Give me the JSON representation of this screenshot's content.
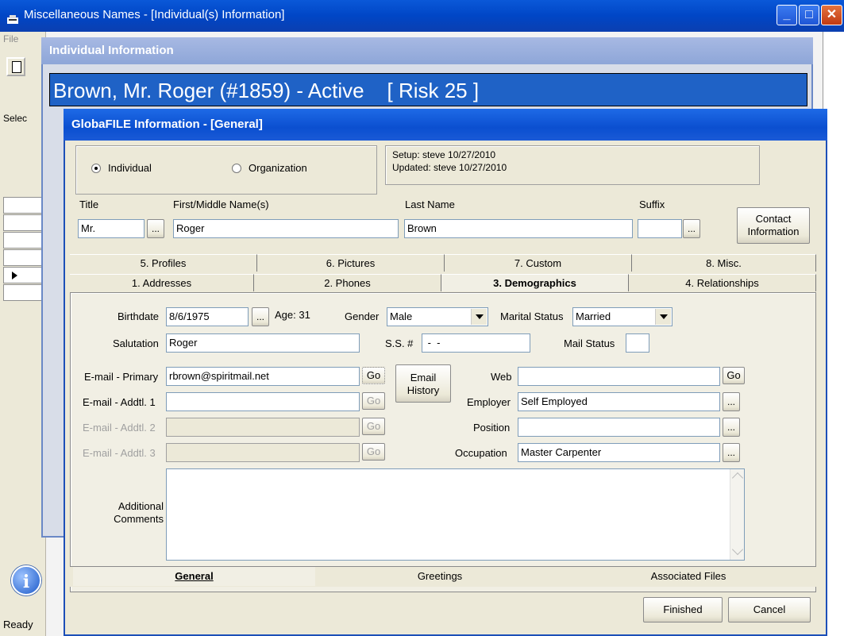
{
  "main_window": {
    "title": "Miscellaneous Names - [Individual(s) Information]",
    "menu_file": "File",
    "select_label": "Selec",
    "status": "Ready",
    "icons": {
      "app": "app-icon",
      "new": "new-document-icon",
      "info": "info-icon"
    }
  },
  "individual_window": {
    "title": "Individual Information",
    "banner": "Brown, Mr. Roger (#1859) - Active    [ Risk 25 ]"
  },
  "dialog": {
    "title": "GlobaFILE Information - [General]",
    "type": {
      "individual": "Individual",
      "organization": "Organization",
      "selected": "Individual"
    },
    "audit": {
      "setup": "Setup: steve 10/27/2010",
      "updated": "Updated: steve 10/27/2010"
    },
    "name": {
      "title_label": "Title",
      "title_value": "Mr.",
      "first_label": "First/Middle Name(s)",
      "first_value": "Roger",
      "last_label": "Last Name",
      "last_value": "Brown",
      "suffix_label": "Suffix",
      "suffix_value": "",
      "dots": "...",
      "contact_button": "Contact Information"
    },
    "tabs_row1": [
      "5. Profiles",
      "6. Pictures",
      "7. Custom",
      "8. Misc."
    ],
    "tabs_row2": [
      "1. Addresses",
      "2. Phones",
      "3. Demographics",
      "4. Relationships"
    ],
    "active_tab": "3. Demographics",
    "demographics": {
      "birthdate_label": "Birthdate",
      "birthdate": "8/6/1975",
      "age": "Age: 31",
      "gender_label": "Gender",
      "gender": "Male",
      "marital_label": "Marital Status",
      "marital": "Married",
      "salutation_label": "Salutation",
      "salutation": "Roger",
      "ss_label": "S.S. #",
      "ss_value": " -  -",
      "mail_status_label": "Mail Status",
      "mail_status": "",
      "email_primary_label": "E-mail - Primary",
      "email_primary": "rbrown@spiritmail.net",
      "email_addtl1_label": "E-mail - Addtl. 1",
      "email_addtl1": "",
      "email_addtl2_label": "E-mail - Addtl. 2",
      "email_addtl2": "",
      "email_addtl3_label": "E-mail - Addtl. 3",
      "email_addtl3": "",
      "go": "Go",
      "email_history": "Email History",
      "web_label": "Web",
      "web": "",
      "employer_label": "Employer",
      "employer": "Self Employed",
      "position_label": "Position",
      "position": "",
      "occupation_label": "Occupation",
      "occupation": "Master Carpenter",
      "comments_label": "Additional Comments",
      "comments": ""
    },
    "bottom_tabs": [
      "General",
      "Greetings",
      "Associated Files"
    ],
    "bottom_active": "General",
    "finished": "Finished",
    "cancel": "Cancel"
  }
}
